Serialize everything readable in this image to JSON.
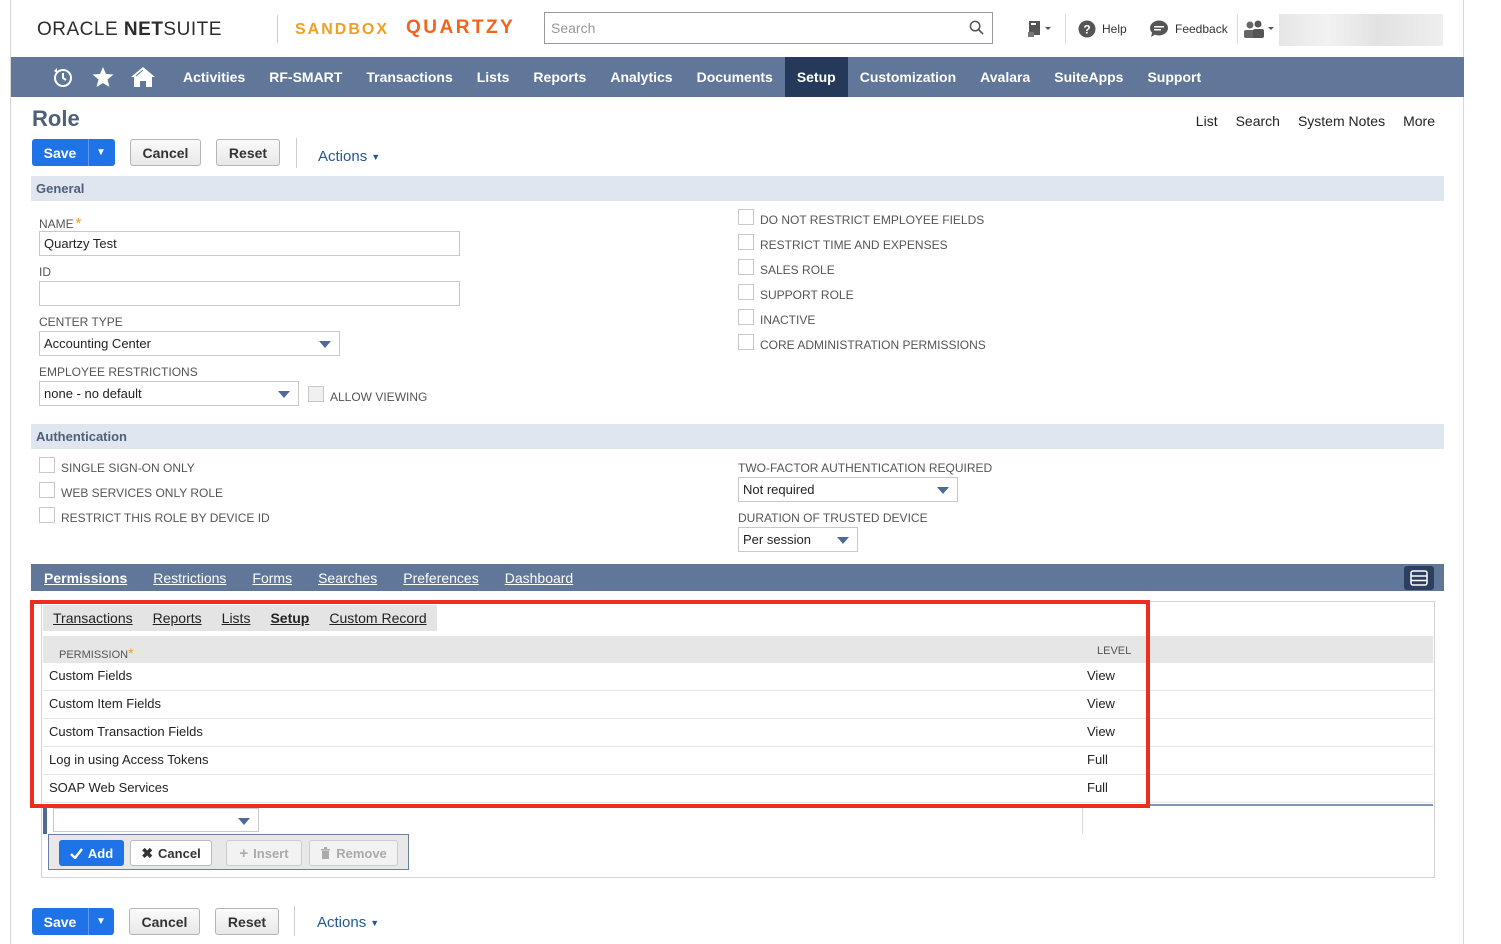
{
  "header": {
    "logo_light": "ORACLE ",
    "logo_bold": "NET",
    "logo_light2": "SUITE",
    "sandbox": "SANDBOX",
    "account": "QUARTZY",
    "search_placeholder": "Search",
    "help": "Help",
    "feedback": "Feedback"
  },
  "nav": {
    "items": [
      "Activities",
      "RF-SMART",
      "Transactions",
      "Lists",
      "Reports",
      "Analytics",
      "Documents",
      "Setup",
      "Customization",
      "Avalara",
      "SuiteApps",
      "Support"
    ],
    "active": "Setup"
  },
  "page": {
    "title": "Role",
    "links": [
      "List",
      "Search",
      "System Notes",
      "More"
    ]
  },
  "buttons": {
    "save": "Save",
    "cancel": "Cancel",
    "reset": "Reset",
    "actions": "Actions"
  },
  "general": {
    "section": "General",
    "name_label": "NAME",
    "name_value": "Quartzy Test",
    "id_label": "ID",
    "id_value": "",
    "center_type_label": "CENTER TYPE",
    "center_type_value": "Accounting Center",
    "emp_restrictions_label": "EMPLOYEE RESTRICTIONS",
    "emp_restrictions_value": "none - no default",
    "allow_viewing": "ALLOW VIEWING",
    "checkboxes": [
      "DO NOT RESTRICT EMPLOYEE FIELDS",
      "RESTRICT TIME AND EXPENSES",
      "SALES ROLE",
      "SUPPORT ROLE",
      "INACTIVE",
      "CORE ADMINISTRATION PERMISSIONS"
    ]
  },
  "auth": {
    "section": "Authentication",
    "checkboxes": [
      "SINGLE SIGN-ON ONLY",
      "WEB SERVICES ONLY ROLE",
      "RESTRICT THIS ROLE BY DEVICE ID"
    ],
    "tfa_label": "TWO-FACTOR AUTHENTICATION REQUIRED",
    "tfa_value": "Not required",
    "duration_label": "DURATION OF TRUSTED DEVICE",
    "duration_value": "Per session"
  },
  "subtabs": {
    "items": [
      "Permissions",
      "Restrictions",
      "Forms",
      "Searches",
      "Preferences",
      "Dashboard"
    ],
    "active": "Permissions"
  },
  "permissions": {
    "tabs": [
      "Transactions",
      "Reports",
      "Lists",
      "Setup",
      "Custom Record"
    ],
    "active_tab": "Setup",
    "col_permission": "PERMISSION",
    "col_level": "LEVEL",
    "rows": [
      {
        "permission": "Custom Fields",
        "level": "View"
      },
      {
        "permission": "Custom Item Fields",
        "level": "View"
      },
      {
        "permission": "Custom Transaction Fields",
        "level": "View"
      },
      {
        "permission": "Log in using Access Tokens",
        "level": "Full"
      },
      {
        "permission": "SOAP Web Services",
        "level": "Full"
      }
    ],
    "add": "Add",
    "cancel": "Cancel",
    "insert": "Insert",
    "remove": "Remove"
  },
  "colors": {
    "nav": "#607799",
    "nav_active": "#25395a",
    "primary": "#1e73e6",
    "highlight": "#ef2d1f"
  }
}
